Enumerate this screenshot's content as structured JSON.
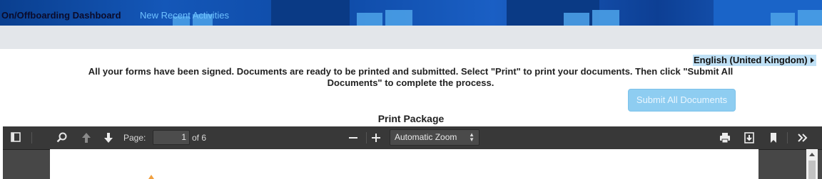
{
  "nav": {
    "title": "On/Offboarding Dashboard",
    "recent_link": "New Recent Activities"
  },
  "language": {
    "selected": "English (United Kingdom)"
  },
  "message": "All your forms have been signed. Documents are ready to be printed and submitted. Select \"Print\" to print your documents. Then click \"Submit All Documents\" to complete the process.",
  "submit_button": "Submit All Documents",
  "package_title": "Print Package",
  "pdf_viewer": {
    "page_label": "Page:",
    "current_page": "1",
    "total_pages": "of 6",
    "zoom": "Automatic Zoom",
    "icons": [
      "sidebar-toggle-icon",
      "search-icon",
      "previous-page-icon",
      "next-page-icon",
      "zoom-out-icon",
      "zoom-in-icon",
      "print-icon",
      "download-icon",
      "bookmark-icon",
      "tools-icon"
    ]
  },
  "colors": {
    "banner": "#1457b8",
    "submit_button": "#8ecdf1",
    "toolbar": "#383838",
    "language_highlight": "#bfe0f5"
  }
}
